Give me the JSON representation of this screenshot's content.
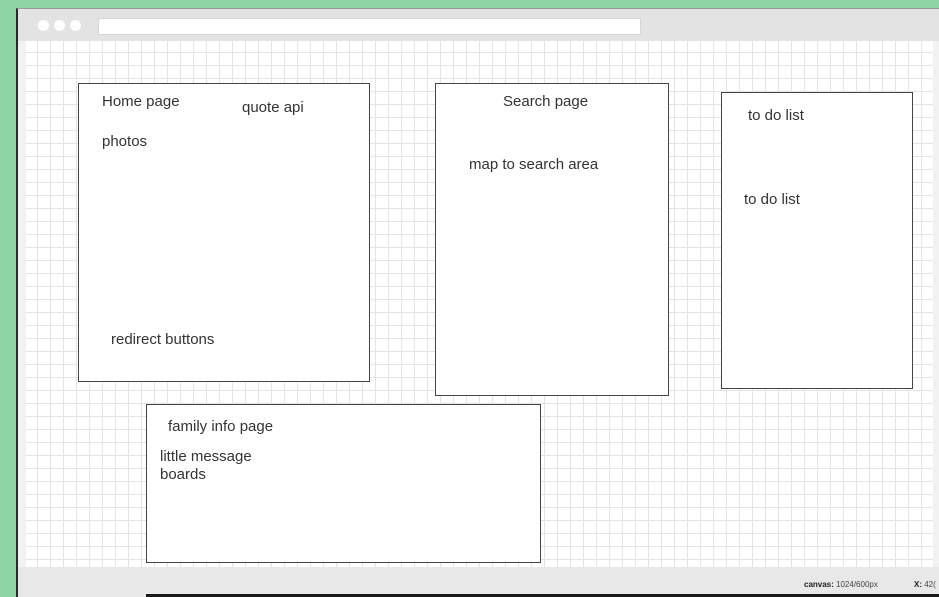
{
  "wireframe": {
    "home_page": {
      "title": "Home page",
      "quote": "quote api",
      "photos": "photos",
      "redirect": "redirect buttons"
    },
    "search_page": {
      "title": "Search page",
      "map": "map to search area"
    },
    "todo_page": {
      "title": "to do list",
      "item": "to do list"
    },
    "family_page": {
      "title": "family info page",
      "message_boards": "little message boards"
    }
  },
  "status": {
    "canvas_label": "canvas:",
    "canvas_value": "1024/600px",
    "x_label": "X:",
    "x_value": "42("
  }
}
